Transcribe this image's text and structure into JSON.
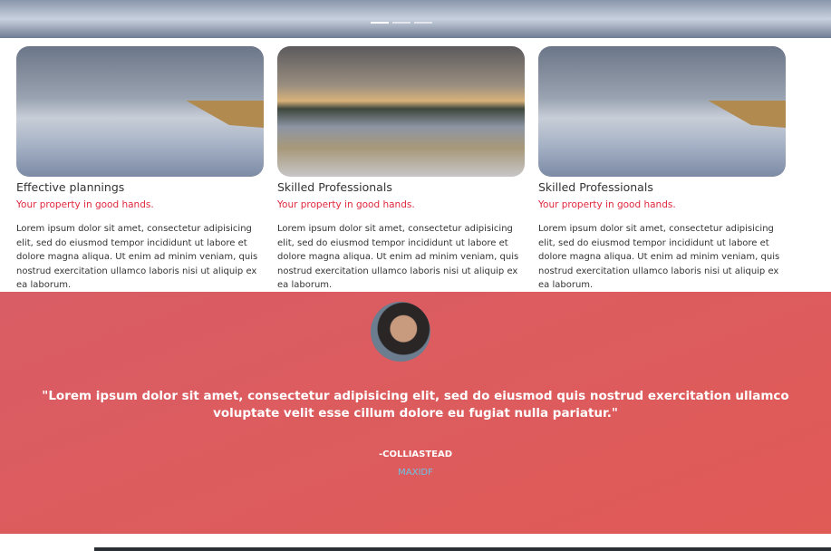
{
  "hero": {
    "slides": 3,
    "active_slide": 1
  },
  "cards": [
    {
      "title": "Effective plannings",
      "subtitle": "Your property in good hands.",
      "text": "Lorem ipsum dolor sit amet, consectetur adipisicing elit, sed do eiusmod tempor incididunt ut labore et dolore magna aliqua. Ut enim ad minim veniam, quis nostrud exercitation ullamco laboris nisi ut aliquip ex ea laborum."
    },
    {
      "title": "Skilled Professionals",
      "subtitle": "Your property in good hands.",
      "text": "Lorem ipsum dolor sit amet, consectetur adipisicing elit, sed do eiusmod tempor incididunt ut labore et dolore magna aliqua. Ut enim ad minim veniam, quis nostrud exercitation ullamco laboris nisi ut aliquip ex ea laborum."
    },
    {
      "title": "Skilled Professionals",
      "subtitle": "Your property in good hands.",
      "text": "Lorem ipsum dolor sit amet, consectetur adipisicing elit, sed do eiusmod tempor incididunt ut labore et dolore magna aliqua. Ut enim ad minim veniam, quis nostrud exercitation ullamco laboris nisi ut aliquip ex ea laborum."
    }
  ],
  "testimonial": {
    "quote": "\"Lorem ipsum dolor sit amet, consectetur adipisicing elit, sed do eiusmod quis nostrud exercitation ullamco voluptate velit esse cillum dolore eu fugiat nulla pariatur.\"",
    "author": "-COLLIASTEAD",
    "role": "MAXIDF"
  },
  "colors": {
    "accent": "#e0283e",
    "band": "#dd5c5e",
    "role": "#6cc3e6"
  }
}
